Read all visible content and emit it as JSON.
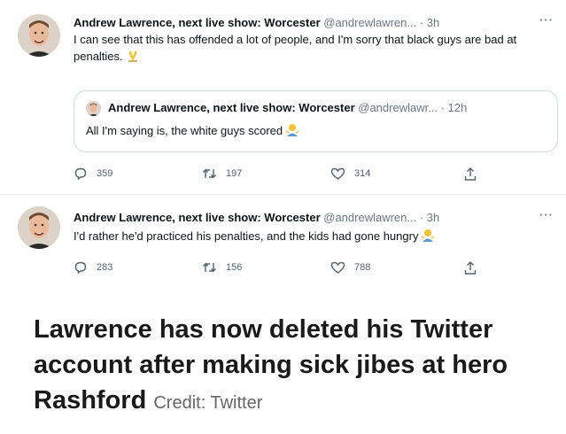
{
  "tweets": [
    {
      "display_name": "Andrew Lawrence, next live show: Worcester",
      "handle_time": "@andrewlawren... · 3h",
      "text": "I can see that this has offended a lot of people, and I'm sorry that black guys are bad at penalties.",
      "quoted": {
        "display_name": "Andrew Lawrence, next live show: Worcester",
        "handle_time": "@andrewlawr... · 12h",
        "text": "All I'm saying is, the white guys scored"
      },
      "replies": "359",
      "retweets": "197",
      "likes": "314"
    },
    {
      "display_name": "Andrew Lawrence, next live show: Worcester",
      "handle_time": "@andrewlawren... · 3h",
      "text": "I'd rather he'd practiced his penalties, and the kids had gone hungry",
      "replies": "283",
      "retweets": "156",
      "likes": "788"
    }
  ],
  "more_glyph": "···",
  "caption": {
    "headline": "Lawrence has now deleted his Twitter account after making sick jibes at hero Rashford",
    "credit": "Credit: Twitter"
  },
  "icons": {
    "reply": "speech-bubble-icon",
    "retweet": "retweet-icon",
    "like": "heart-icon",
    "share": "share-icon",
    "emoji_1": "folded-hands-emoji",
    "emoji_2": "person-shrugging-emoji"
  },
  "colors": {
    "muted": "#536471",
    "border": "#cfd9de",
    "emoji_yellow": "#f4c232"
  }
}
